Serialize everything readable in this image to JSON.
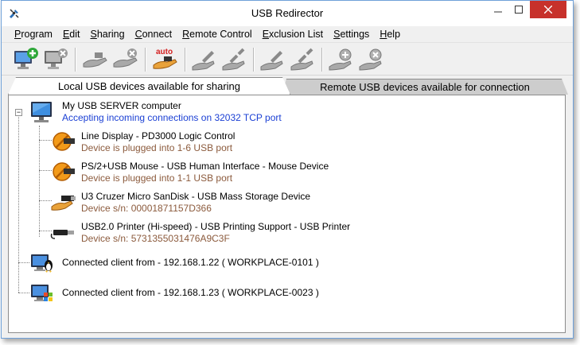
{
  "window": {
    "title": "USB Redirector"
  },
  "menu": [
    {
      "label": "Program",
      "u": "P",
      "rest": "rogram"
    },
    {
      "label": "Edit",
      "u": "E",
      "rest": "dit"
    },
    {
      "label": "Sharing",
      "u": "S",
      "rest": "haring"
    },
    {
      "label": "Connect",
      "u": "C",
      "rest": "onnect"
    },
    {
      "label": "Remote Control",
      "u": "R",
      "rest": "emote Control"
    },
    {
      "label": "Exclusion List",
      "u": "E",
      "rest": "xclusion List"
    },
    {
      "label": "Settings",
      "u": "S",
      "rest": "ettings"
    },
    {
      "label": "Help",
      "u": "H",
      "rest": "elp"
    }
  ],
  "toolbar": {
    "auto_label": "auto"
  },
  "tabs": {
    "local": "Local USB devices available for sharing",
    "remote": "Remote USB devices available for connection"
  },
  "tree": {
    "server": {
      "name": "My USB SERVER computer",
      "status": "Accepting incoming connections on 32032 TCP port"
    },
    "devices": [
      {
        "name": "Line Display - PD3000 Logic Control",
        "detail": "Device is plugged into 1-6 USB port"
      },
      {
        "name": "PS/2+USB Mouse - USB Human Interface - Mouse Device",
        "detail": "Device is plugged into 1-1 USB port"
      },
      {
        "name": "U3 Cruzer Micro SanDisk - USB Mass Storage Device",
        "detail": "Device s/n: 00001871157D366"
      },
      {
        "name": "USB2.0 Printer (Hi-speed) - USB Printing Support - USB Printer",
        "detail": "Device s/n: 5731355031476A9C3F"
      }
    ],
    "clients": [
      {
        "label": "Connected client from - 192.168.1.22 ( WORKPLACE-0101 )"
      },
      {
        "label": "Connected client from - 192.168.1.23 ( WORKPLACE-0023 )"
      }
    ]
  },
  "colors": {
    "accent_blue": "#1a3fd4",
    "detail_brown": "#8b5a3c",
    "close_red": "#c7312b"
  }
}
